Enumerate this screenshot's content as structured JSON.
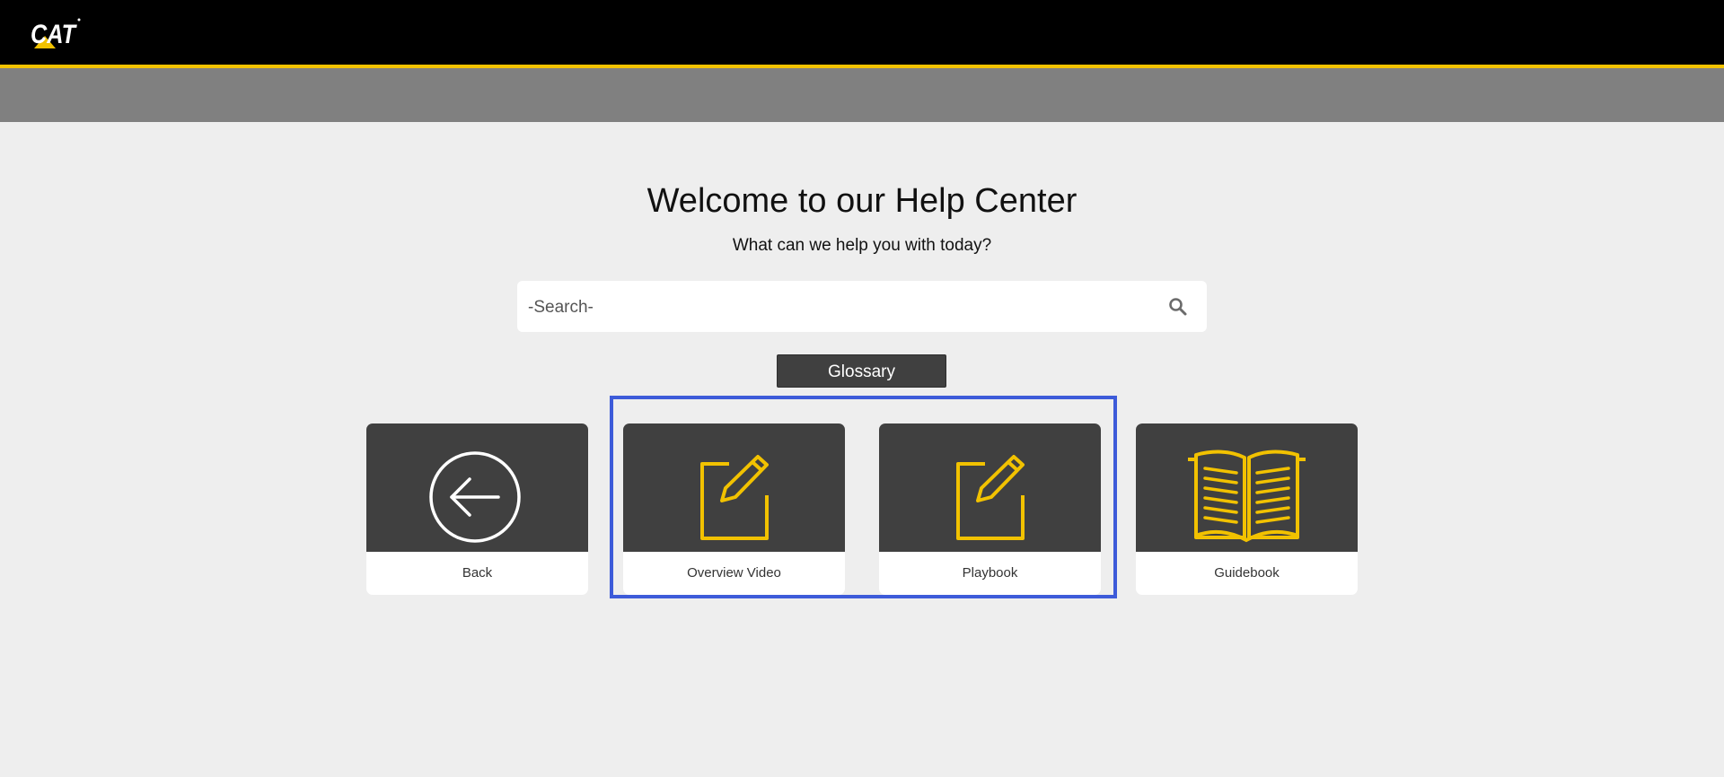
{
  "header": {
    "logo_text": "CAT",
    "brand_yellow": "#f2c200"
  },
  "main": {
    "title": "Welcome to our Help Center",
    "subtitle": "What can we help you with today?",
    "search": {
      "placeholder": "-Search-",
      "value": "",
      "icon": "search-icon"
    },
    "glossary_label": "Glossary",
    "cards": [
      {
        "label": "Back",
        "icon": "back-arrow-circle-icon"
      },
      {
        "label": "Overview Video",
        "icon": "edit-note-icon"
      },
      {
        "label": "Playbook",
        "icon": "edit-note-icon"
      },
      {
        "label": "Guidebook",
        "icon": "open-book-icon"
      }
    ],
    "highlight_color": "#3d5bd9"
  }
}
